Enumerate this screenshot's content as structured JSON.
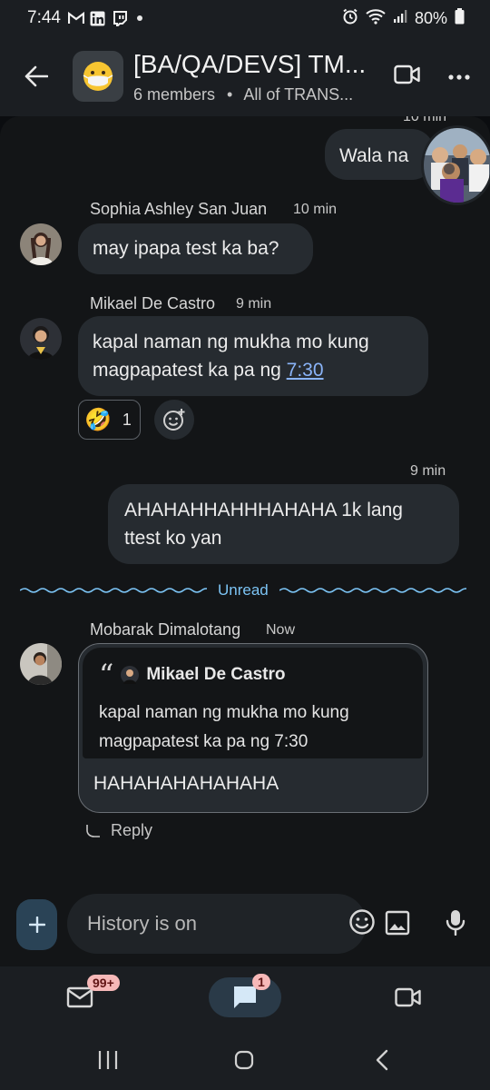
{
  "status_bar": {
    "time": "7:44",
    "battery": "80%"
  },
  "header": {
    "title": "[BA/QA/DEVS] TM...",
    "members": "6 members",
    "separator": "•",
    "subtitle_rest": "All of TRANS..."
  },
  "messages": {
    "top_time": "10 min",
    "m1": {
      "text": "Wala na"
    },
    "m2": {
      "sender": "Sophia Ashley San Juan",
      "time": "10 min",
      "text": "may ipapa test ka ba?"
    },
    "m3": {
      "sender": "Mikael De Castro",
      "time": "9 min",
      "text_before_link": "kapal naman ng mukha mo kung magpapatest ka pa ng ",
      "link": "7:30"
    },
    "reaction": {
      "emoji": "🤣",
      "count": "1"
    },
    "m4": {
      "time": "9 min",
      "text": "AHAHAHHAHHHAHAHA 1k lang ttest ko yan"
    },
    "unread_label": "Unread",
    "m5": {
      "sender": "Mobarak Dimalotang",
      "time": "Now",
      "quote_author": "Mikael De Castro",
      "quote_text": "kapal naman ng mukha mo kung magpapatest ka pa ng 7:30",
      "text": "HAHAHAHAHAHAHA",
      "reply_label": "Reply"
    }
  },
  "composer": {
    "placeholder": "History is on"
  },
  "bottom_nav": {
    "mail_badge": "99+",
    "chat_badge": "1"
  },
  "colors": {
    "bg": "#131517",
    "bubble": "#262b30",
    "accent": "#8ab4f8",
    "unread": "#7cc4f5"
  }
}
